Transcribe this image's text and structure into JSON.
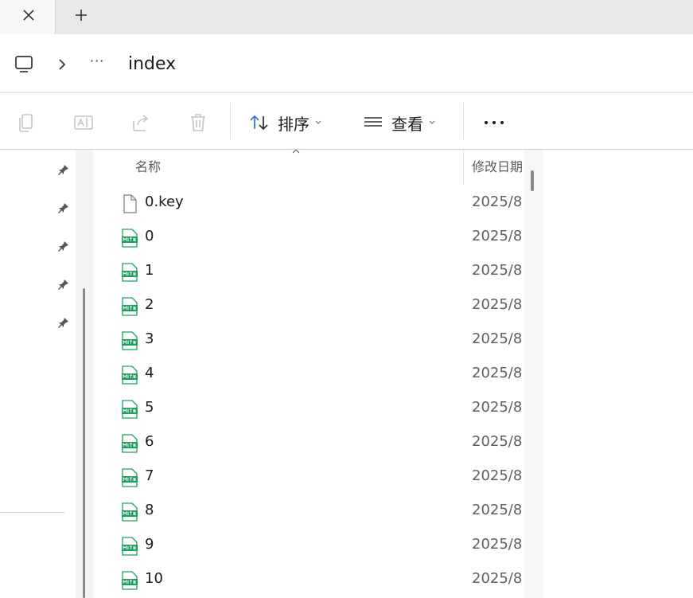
{
  "tabs": {
    "close_icon": "close-icon",
    "new_tab_icon": "plus-icon"
  },
  "address": {
    "more_label": "···",
    "current_folder": "index"
  },
  "toolbar": {
    "sort_label": "排序",
    "view_label": "查看",
    "more_label": "···"
  },
  "columns": {
    "name": "名称",
    "date": "修改日期"
  },
  "files": [
    {
      "name": "0.key",
      "date": "2025/8",
      "type": "generic"
    },
    {
      "name": "0",
      "date": "2025/8",
      "type": "media"
    },
    {
      "name": "1",
      "date": "2025/8",
      "type": "media"
    },
    {
      "name": "2",
      "date": "2025/8",
      "type": "media"
    },
    {
      "name": "3",
      "date": "2025/8",
      "type": "media"
    },
    {
      "name": "4",
      "date": "2025/8",
      "type": "media"
    },
    {
      "name": "5",
      "date": "2025/8",
      "type": "media"
    },
    {
      "name": "6",
      "date": "2025/8",
      "type": "media"
    },
    {
      "name": "7",
      "date": "2025/8",
      "type": "media"
    },
    {
      "name": "8",
      "date": "2025/8",
      "type": "media"
    },
    {
      "name": "9",
      "date": "2025/8",
      "type": "media"
    },
    {
      "name": "10",
      "date": "2025/8",
      "type": "media"
    }
  ],
  "colors": {
    "accent": "#2a7de1",
    "media_icon": "#1aa060"
  }
}
